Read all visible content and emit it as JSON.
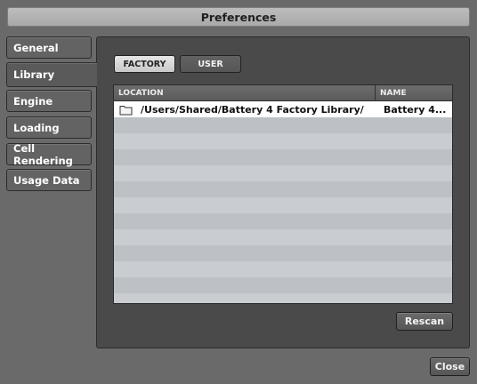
{
  "window": {
    "title": "Preferences"
  },
  "sidebar": {
    "items": [
      {
        "label": "General",
        "active": false
      },
      {
        "label": "Library",
        "active": true
      },
      {
        "label": "Engine",
        "active": false
      },
      {
        "label": "Loading",
        "active": false
      },
      {
        "label": "Cell Rendering",
        "active": false
      },
      {
        "label": "Usage Data",
        "active": false
      }
    ]
  },
  "library": {
    "segments": {
      "factory": "FACTORY",
      "user": "USER",
      "selected": "FACTORY"
    },
    "table": {
      "columns": {
        "location": "LOCATION",
        "name": "NAME"
      },
      "rows": [
        {
          "location": "/Users/Shared/Battery 4 Factory Library/",
          "name": "Battery 4...",
          "icon": "folder-icon"
        }
      ]
    },
    "rescan_label": "Rescan"
  },
  "footer": {
    "close_label": "Close"
  },
  "colors": {
    "background": "#6a6a6a",
    "panel": "#4a4a4a",
    "row_light": "#c9cdd1",
    "row_dark": "#bdc1c5"
  }
}
